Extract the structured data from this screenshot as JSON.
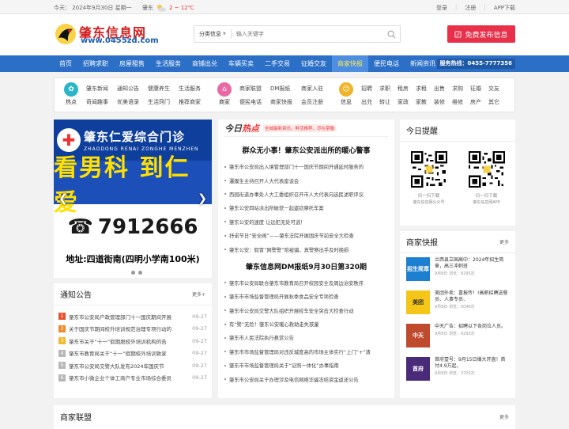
{
  "topbar": {
    "date": "今天： 2024年9月30日 星期一",
    "city": "肇东",
    "temp": "2 ~ 12℃",
    "login": "登录",
    "register": "注册",
    "app": "APP下载"
  },
  "header": {
    "logo_name": "肇东信息网",
    "logo_url": "www.0455zd.com",
    "search_category": "分类信息",
    "search_placeholder": "输入关键字",
    "publish_label": "免费发布信息"
  },
  "nav": {
    "items": [
      "首页",
      "招聘求职",
      "房屋租售",
      "生活服务",
      "商铺出兑",
      "车辆买卖",
      "二手交易",
      "征婚交友",
      "商家快报",
      "便民电话",
      "新闻资讯"
    ],
    "phone": "服务热线：0455-7777356"
  },
  "categories": {
    "hot": {
      "label": "热点",
      "links": [
        "肇东新闻",
        "通知公告",
        "健康养生",
        "生活服务",
        "奇闻趣事",
        "优美语录",
        "生活窍门",
        "推荐商家"
      ]
    },
    "shop": {
      "label": "商家",
      "links": [
        "商家联盟",
        "DM报纸",
        "商家入驻",
        "便民电话",
        "商家快报",
        "会员注册"
      ]
    },
    "info": {
      "label": "信息",
      "links": [
        "招聘",
        "求职",
        "租房",
        "求租",
        "出售",
        "求购",
        "征婚",
        "交友",
        "出兑",
        "转让",
        "家政",
        "家教",
        "装修",
        "维修",
        "房产",
        "其它"
      ]
    }
  },
  "banner": {
    "title": "肇东仁爱综合门诊",
    "title_en": "ZHAODONG RENAI ZONGHE MENZHEN",
    "slogan": "看男科 到仁爱",
    "phone": "7912666",
    "address": "地址:四道街南(四明小学南100米)"
  },
  "notice": {
    "title": "通知公告",
    "more": "更多+",
    "items": [
      {
        "num": "1",
        "text": "肇东市公安局户政管理部门十一国庆期间开展",
        "date": "09-27"
      },
      {
        "num": "2",
        "text": "关于国庆节期间校外培训规范治理专项行动的",
        "date": "09-27"
      },
      {
        "num": "3",
        "text": "肇东市关于“十一”假期脱校外培训机构的告",
        "date": "09-27"
      },
      {
        "num": "4",
        "text": "肇东市教育局关于“十一”假期校外培训致家",
        "date": "09-27"
      },
      {
        "num": "5",
        "text": "肇东市公安局交警大队发布2024年国庆节",
        "date": "09-27"
      },
      {
        "num": "6",
        "text": "肇东市小微企业个体工商户专业市场综合委员",
        "date": "09-27"
      }
    ]
  },
  "news": {
    "logo_a": "今日",
    "logo_b": "热点",
    "tag": "全城最新资讯，鲜活推荐，尽在掌握",
    "headline1": "群众无小事！肇东公安派出所的暖心警事",
    "list1": [
      "肇东市公安局出入境管理部门十一国庆节期间开通延时服务的",
      "瀑膜生主持召开人大代表座谈会",
      "西园街道办事处人大工委组织召开市人大代表向选民述职评议",
      "肇东公安四站派出所破获一起盗窃摩托车案",
      "肇东公安的速度 让远犯无处可逃！",
      "抒诺节日“安全阀”——肇东法院开展国庆节前安全大检查",
      "肇东公安：假冒“网警警”陪被骗，真警察出手及时挽损"
    ],
    "headline2": "肇东信息网DM报纸9月30日第320期",
    "list2": [
      "肇东市公安局联合肇东市教育局召开校园安全及周边治安秩序",
      "肇东市市场监督管理局开展秋季食品安全专项检查",
      "肇东市公安局交警大队组织开展校车安全突击大检查行动",
      "有“警”无险！肇东公安暖心救助走失孩童",
      "肇东市人民法院执行悬赏公告",
      "肇东市市场监督管理局对违反城度高的市场主体实行“上门”+“清",
      "肇东市市场监督管理局关于“证照一体化”办事指南",
      "肇东市公安局关于办理涉及电信网络诈骗冻结资金返还公告"
    ]
  },
  "today": {
    "title": "今日提醒",
    "qr1_c1": "扫一扫下载",
    "qr1_c2": "肇东信息网公众号",
    "qr2_c1": "扫一扫下载",
    "qr2_c2": "肇东信息网APP"
  },
  "shops": {
    "title": "商家快报",
    "more": "更多",
    "items": [
      {
        "thumb": "招生简章",
        "title": "兰西县立国高中：2024年招生简章，高三冲刺班",
        "meta": "9月8日   浏览：8295次",
        "color": "#1d7fd1"
      },
      {
        "thumb": "美团",
        "title": "美团外卖：喜报传！!高薪招聘送餐员、人事专员、",
        "meta": "9月8日   浏览：5040次",
        "color": "#f5c518"
      },
      {
        "thumb": "中天",
        "title": "中天广告：招聘以下各岗位人员。",
        "meta": "9月8日   浏览：4293次",
        "color": "#c04a2e"
      },
      {
        "thumb": "首府",
        "title": "首府壹号：9月15日爆大开盘！首付4.9万起，",
        "meta": "9月8日   浏览：3703次",
        "color": "#4a2b7a"
      }
    ]
  },
  "union": {
    "title": "商家联盟",
    "more": "更多"
  },
  "colors": {
    "nav_blue": "#2b6fc7",
    "brand_red": "#d21e1e",
    "publish_red": "#e8304a",
    "hot_teal": "#2bb6c7",
    "shop_pink": "#e86aa5",
    "info_yellow": "#f0b429"
  }
}
